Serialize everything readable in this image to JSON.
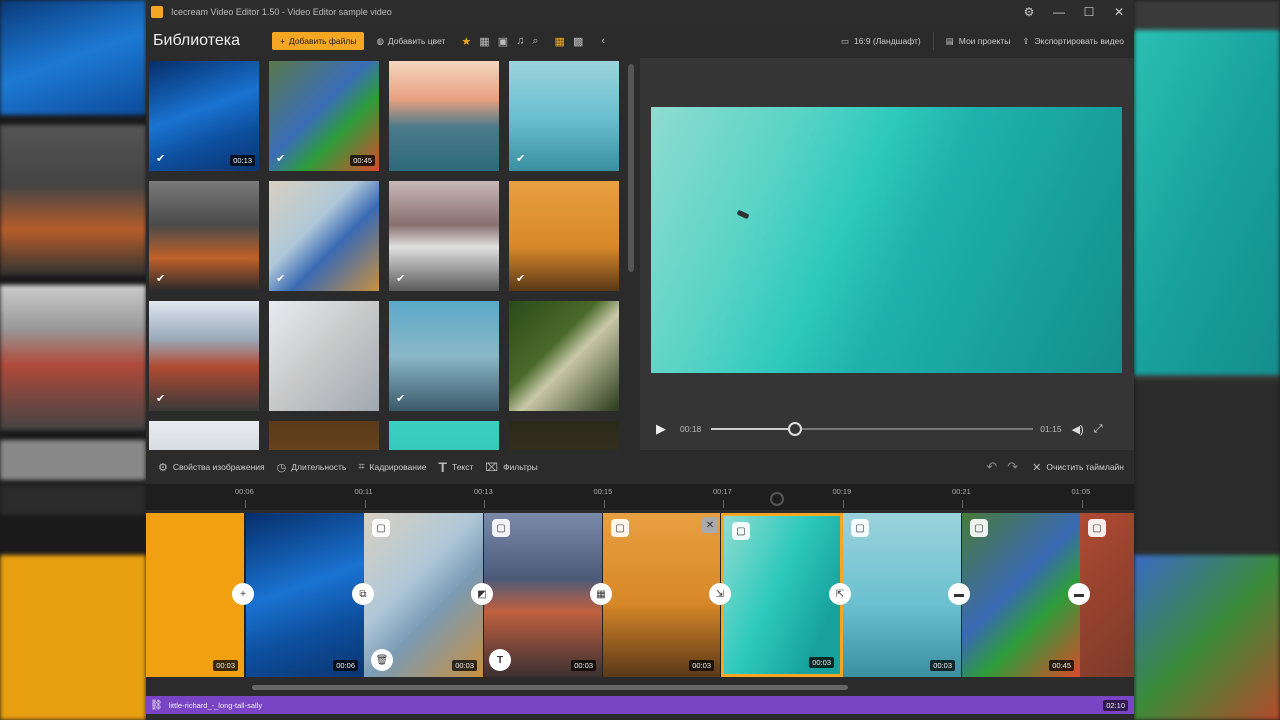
{
  "window": {
    "title": "Icecream Video Editor 1.50 - Video Editor sample video",
    "controls": {
      "settings": "⚙",
      "minimize": "—",
      "maximize": "☐",
      "close": "✕"
    }
  },
  "library": {
    "title": "Библиотека",
    "add_files": "Добавить файлы",
    "add_color": "Добавить цвет",
    "thumbs": [
      {
        "dur": "00:13",
        "checked": true
      },
      {
        "dur": "00:45",
        "checked": true
      },
      {
        "dur": "",
        "checked": false
      },
      {
        "dur": "",
        "checked": true
      },
      {
        "dur": "",
        "checked": true
      },
      {
        "dur": "",
        "checked": true
      },
      {
        "dur": "",
        "checked": true
      },
      {
        "dur": "",
        "checked": true
      },
      {
        "dur": "",
        "checked": true
      },
      {
        "dur": "",
        "checked": false
      },
      {
        "dur": "",
        "checked": true
      },
      {
        "dur": "",
        "checked": false
      }
    ]
  },
  "preview": {
    "aspect": "16:9 (Ландшафт)",
    "my_projects": "Мои проекты",
    "export": "Экспортировать видео",
    "current_time": "00:18",
    "total_time": "01:15",
    "progress": 0.26
  },
  "tools": {
    "image_props": "Свойства изображения",
    "duration": "Длительность",
    "crop": "Кадрирование",
    "text": "Текст",
    "filters": "Фильтры",
    "clear": "Очистить таймлайн"
  },
  "ruler": {
    "ticks": [
      "00:06",
      "00:11",
      "00:13",
      "00:15",
      "00:17",
      "00:19",
      "00:21",
      "01:05"
    ]
  },
  "clips": [
    {
      "dur": "00:03"
    },
    {
      "dur": "00:06"
    },
    {
      "dur": "00:03"
    },
    {
      "dur": "00:03"
    },
    {
      "dur": "00:03"
    },
    {
      "dur": "00:03"
    },
    {
      "dur": "00:03"
    },
    {
      "dur": "00:45"
    },
    {
      "dur": ""
    }
  ],
  "audio": {
    "name": "little-richard_-_long-tall-sally",
    "duration": "02:10"
  },
  "colors": {
    "accent": "#f5a623",
    "audio": "#7a45c4"
  }
}
